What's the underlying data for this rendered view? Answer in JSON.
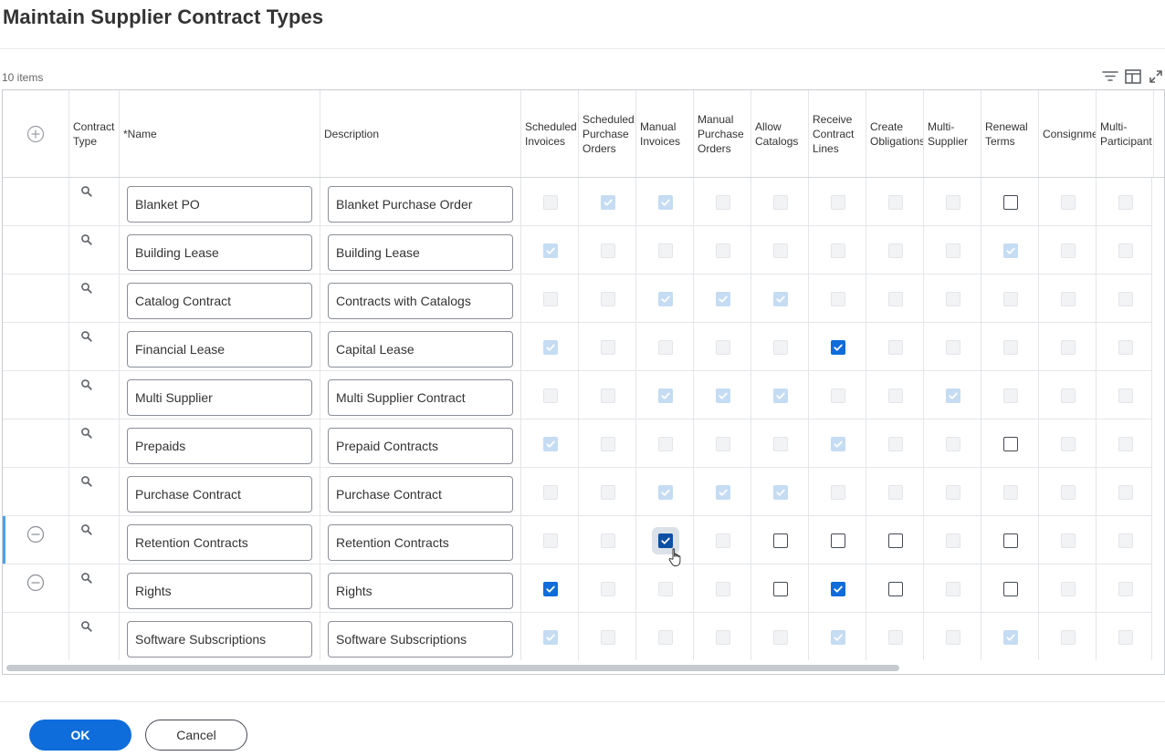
{
  "page": {
    "title": "Maintain Supplier Contract Types",
    "item_count": "10 items"
  },
  "toolbar": {
    "icons": [
      "filter-icon",
      "column-chooser-icon",
      "fullscreen-icon"
    ]
  },
  "columns": {
    "contract_type": "Contract\nType",
    "name": "*Name",
    "description": "Description",
    "checkbox_headers": [
      "Scheduled\nInvoices",
      "Scheduled\nPurchase\nOrders",
      "Manual\nInvoices",
      "Manual\nPurchase\nOrders",
      "Allow\nCatalogs",
      "Receive\nContract\nLines",
      "Create\nObligations",
      "Multi-\nSupplier",
      "Renewal\nTerms",
      "Consignment",
      "Multi-\nParticipant"
    ]
  },
  "checkbox_state_legend": {
    "d": "disabled unchecked",
    "D": "disabled checked",
    "e": "enabled unchecked",
    "c": "enabled checked",
    "f": "enabled checked, focused"
  },
  "rows": [
    {
      "name": "Blanket PO",
      "description": "Blanket Purchase Order",
      "removable": false,
      "selected": false,
      "checks": [
        "d",
        "D",
        "D",
        "d",
        "d",
        "d",
        "d",
        "d",
        "e",
        "d",
        "d"
      ]
    },
    {
      "name": "Building Lease",
      "description": "Building Lease",
      "removable": false,
      "selected": false,
      "checks": [
        "D",
        "d",
        "d",
        "d",
        "d",
        "d",
        "d",
        "d",
        "D",
        "d",
        "d"
      ]
    },
    {
      "name": "Catalog Contract",
      "description": "Contracts with Catalogs",
      "removable": false,
      "selected": false,
      "checks": [
        "d",
        "d",
        "D",
        "D",
        "D",
        "d",
        "d",
        "d",
        "d",
        "d",
        "d"
      ]
    },
    {
      "name": "Financial Lease",
      "description": "Capital Lease",
      "removable": false,
      "selected": false,
      "checks": [
        "D",
        "d",
        "d",
        "d",
        "d",
        "c",
        "d",
        "d",
        "d",
        "d",
        "d"
      ]
    },
    {
      "name": "Multi Supplier",
      "description": "Multi Supplier Contract",
      "removable": false,
      "selected": false,
      "checks": [
        "d",
        "d",
        "D",
        "D",
        "D",
        "d",
        "d",
        "D",
        "d",
        "d",
        "d"
      ]
    },
    {
      "name": "Prepaids",
      "description": "Prepaid Contracts",
      "removable": false,
      "selected": false,
      "checks": [
        "D",
        "d",
        "d",
        "d",
        "d",
        "D",
        "d",
        "d",
        "e",
        "d",
        "d"
      ]
    },
    {
      "name": "Purchase Contract",
      "description": "Purchase Contract",
      "removable": false,
      "selected": false,
      "checks": [
        "d",
        "d",
        "D",
        "D",
        "D",
        "d",
        "d",
        "d",
        "d",
        "d",
        "d"
      ]
    },
    {
      "name": "Retention Contracts",
      "description": "Retention Contracts",
      "removable": true,
      "selected": true,
      "checks": [
        "d",
        "d",
        "f",
        "d",
        "e",
        "e",
        "e",
        "d",
        "e",
        "d",
        "d"
      ]
    },
    {
      "name": "Rights",
      "description": "Rights",
      "removable": true,
      "selected": false,
      "checks": [
        "c",
        "d",
        "d",
        "d",
        "e",
        "c",
        "e",
        "d",
        "e",
        "d",
        "d"
      ]
    },
    {
      "name": "Software Subscriptions",
      "description": "Software Subscriptions",
      "removable": false,
      "selected": false,
      "checks": [
        "D",
        "d",
        "d",
        "d",
        "d",
        "D",
        "d",
        "d",
        "D",
        "d",
        "d"
      ]
    }
  ],
  "buttons": {
    "ok": "OK",
    "cancel": "Cancel"
  },
  "colors": {
    "primary": "#0e6cdb",
    "selected_row_indicator": "#4f9fe7",
    "disabled_checked": "#c5dcf2"
  }
}
